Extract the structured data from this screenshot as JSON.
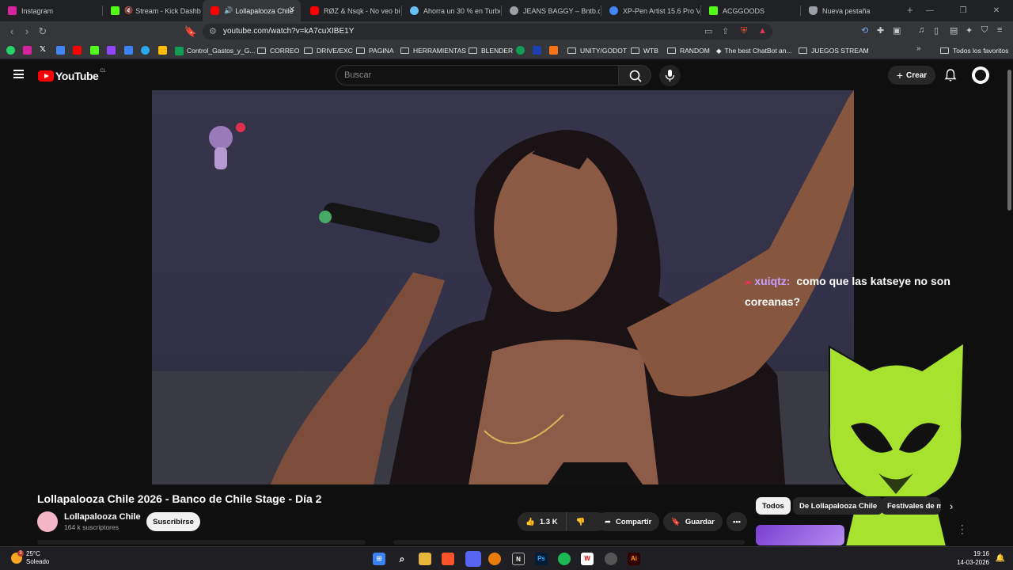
{
  "tabs": [
    {
      "label": "Instagram",
      "color": "#d6249f"
    },
    {
      "label": "Stream - Kick Dashboa",
      "color": "#53fc18"
    },
    {
      "label": "Lollapalooza Chile",
      "color": "#ff0000"
    },
    {
      "label": "RØZ & Nsqk - No veo bie",
      "color": "#ff0000"
    },
    {
      "label": "Ahorra un 30 % en Turbo",
      "color": "#66c0f4"
    },
    {
      "label": "JEANS BAGGY – Bntb.cl",
      "color": "#9aa0a6"
    },
    {
      "label": "XP-Pen Artist 15.6 Pro V2",
      "color": "#4285f4"
    },
    {
      "label": "ACGGOODS",
      "color": "#53fc18"
    },
    {
      "label": "Nueva pestaña",
      "color": "#9aa0a6"
    }
  ],
  "url": "youtube.com/watch?v=kA7cuXIBE1Y",
  "bookmarks": [
    {
      "label": "Control_Gastos_y_G...",
      "type": "sheet"
    },
    {
      "label": "CORREO",
      "type": "folder"
    },
    {
      "label": "DRIVE/EXC",
      "type": "folder"
    },
    {
      "label": "PAGINA",
      "type": "folder"
    },
    {
      "label": "HERRAMIENTAS",
      "type": "folder"
    },
    {
      "label": "BLENDER",
      "type": "folder"
    },
    {
      "label": "UNITY/GODOT",
      "type": "folder"
    },
    {
      "label": "WTB",
      "type": "folder"
    },
    {
      "label": "RANDOM",
      "type": "folder"
    },
    {
      "label": "The best ChatBot an...",
      "type": "site"
    },
    {
      "label": "JUEGOS STREAM",
      "type": "folder"
    }
  ],
  "all_favorites": "Todos los favoritos",
  "yt": {
    "wordmark": "YouTube",
    "region": "CL",
    "search_placeholder": "Buscar",
    "create": "Crear"
  },
  "chat": {
    "user": "xuiqtz:",
    "message": "como que las katseye no son coreanas?"
  },
  "video": {
    "title": "Lollapalooza Chile 2026 - Banco de Chile Stage - Día 2",
    "channel": "Lollapalooza Chile",
    "subscribers": "164 k suscriptores",
    "subscribe": "Suscribirse",
    "likes": "1.3 K",
    "share": "Compartir",
    "save": "Guardar"
  },
  "chips": [
    "Todos",
    "De Lollapalooza Chile",
    "Festivales de m"
  ],
  "taskbar": {
    "temp": "25°C",
    "condition": "Soleado",
    "time": "19:16",
    "date": "14-03-2026",
    "weather_badge": "3"
  }
}
